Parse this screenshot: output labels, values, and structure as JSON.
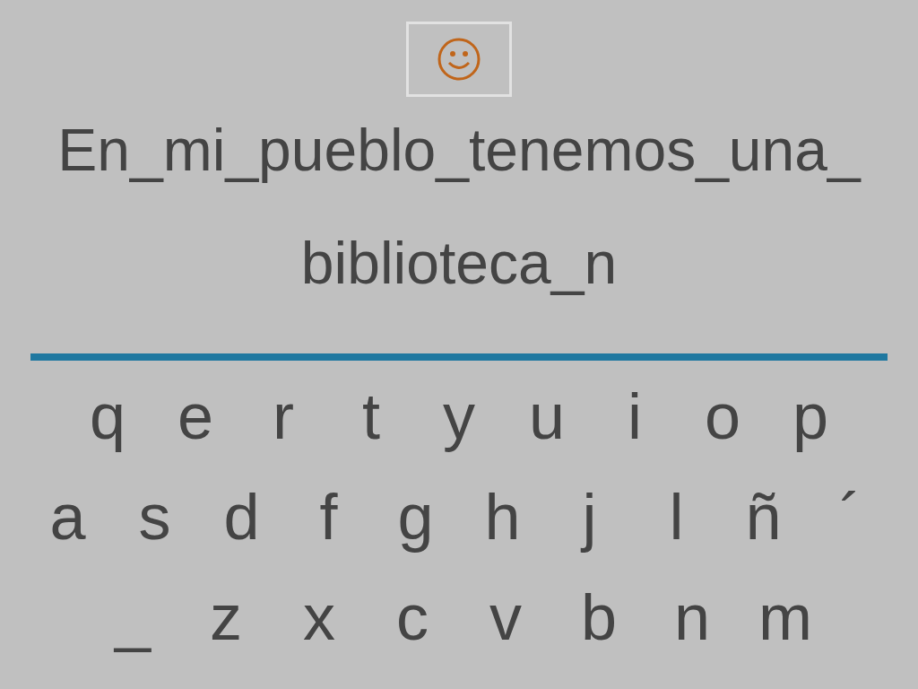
{
  "sentence_lines": [
    "En_mi_pueblo_tenemos_una_",
    "biblioteca_n"
  ],
  "keyboard_rows": [
    [
      "q",
      "e",
      "r",
      "t",
      "y",
      "u",
      "i",
      "o",
      "p"
    ],
    [
      "a",
      "s",
      "d",
      "f",
      "g",
      "h",
      "j",
      "l",
      "ñ",
      "´"
    ],
    [
      "_",
      "z",
      "x",
      "c",
      "v",
      "b",
      "n",
      "m"
    ]
  ]
}
